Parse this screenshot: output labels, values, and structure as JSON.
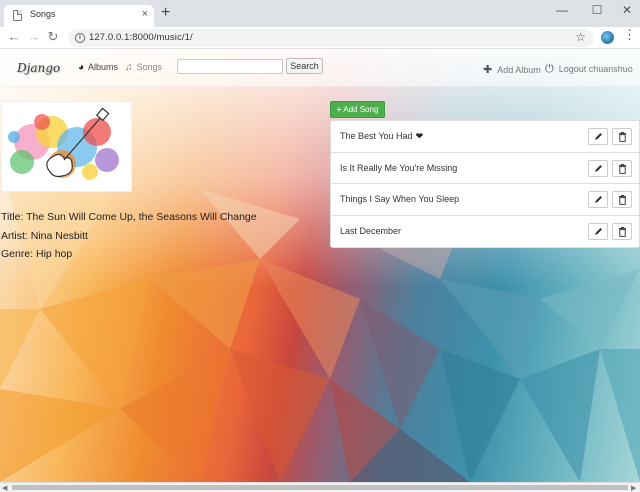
{
  "browser": {
    "tab_title": "Songs",
    "tab_close": "×",
    "new_tab": "+",
    "url": "127.0.0.1:8000/music/1/",
    "window_controls": {
      "minimize": "—",
      "maximize": "☐",
      "close": "✕"
    },
    "icons": [
      "back-arrow-icon",
      "forward-arrow-icon",
      "reload-icon",
      "info-icon",
      "star-icon",
      "profile-icon",
      "menu-icon"
    ]
  },
  "navbar": {
    "brand": "Django",
    "albums_label": "Albums",
    "songs_label": "Songs",
    "search_value": "",
    "search_button": "Search",
    "add_album_label": "Add Album",
    "logout_label": "Logout chuanshuo"
  },
  "album": {
    "title_line": "Title: The Sun Will Come Up, the Seasons Will Change",
    "artist_line": "Artist: Nina Nesbitt",
    "genre_line": "Genre: Hip hop"
  },
  "add_song_label": "Add Song",
  "songs": [
    {
      "title": "The Best You Had",
      "favorite": true
    },
    {
      "title": "Is It Really Me You're Missing",
      "favorite": false
    },
    {
      "title": "Things I Say When You Sleep",
      "favorite": false
    },
    {
      "title": "Last December",
      "favorite": false
    }
  ],
  "colors": {
    "success": "#4cae4c",
    "chrome": "#dee1e6"
  }
}
